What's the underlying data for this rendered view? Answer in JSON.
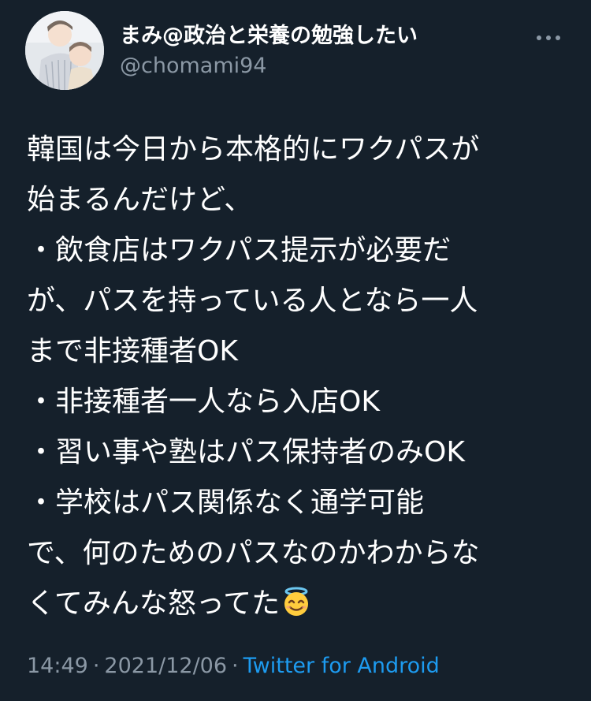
{
  "tweet": {
    "author": {
      "display_name": "まみ@政治と栄養の勉強したい",
      "handle": "@chomami94"
    },
    "lines": [
      "韓国は今日から本格的にワクパスが",
      "始まるんだけど、",
      "・飲食店はワクパス提示が必要だ",
      "が、パスを持っている人となら一人",
      "まで非接種者OK",
      "・非接種者一人なら入店OK",
      "・習い事や塾はパス保持者のみOK",
      "・学校はパス関係なく通学可能",
      "で、何のためのパスなのかわからな",
      "くてみんな怒ってた"
    ],
    "emoji_icon": "smiling-face-with-halo-icon",
    "time": "14:49",
    "date": "2021/12/06",
    "separator": "·",
    "source": "Twitter for Android"
  },
  "colors": {
    "background": "#15202b",
    "text": "#ffffff",
    "secondary": "#8b98a5",
    "link": "#1d9bf0"
  }
}
